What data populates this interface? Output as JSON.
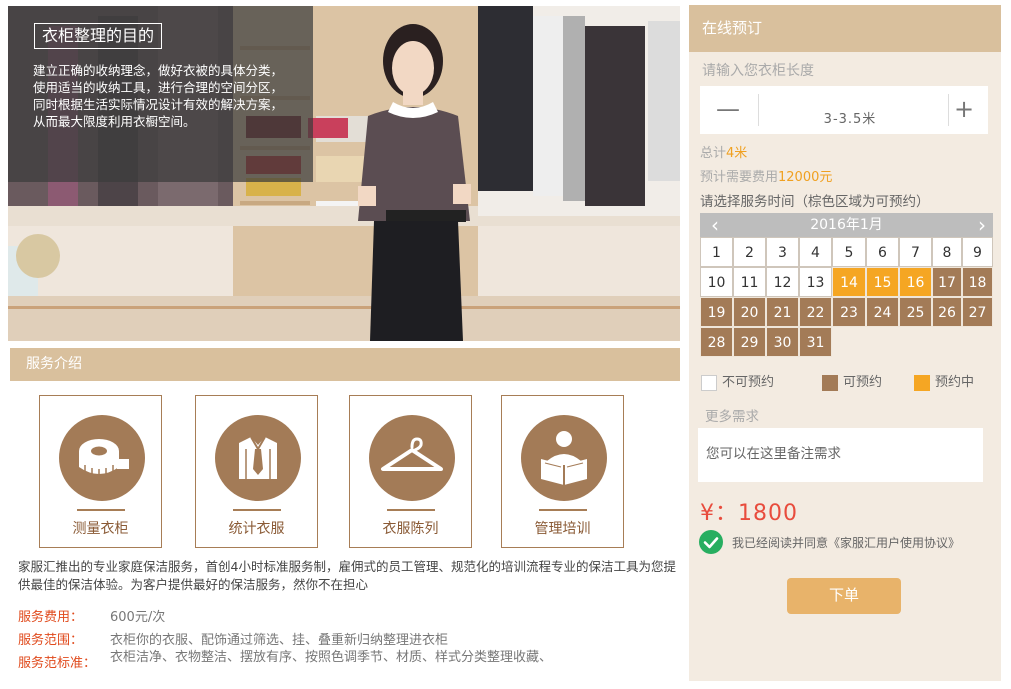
{
  "hero": {
    "title": "衣柜整理的目的",
    "text": "建立正确的收纳理念，做好衣被的具体分类，使用适当的收纳工具，进行合理的空间分区，同时根据生活实际情况设计有效的解决方案，从而最大限度利用衣橱空间。"
  },
  "services": {
    "header": "服务介绍",
    "items": [
      {
        "label": "测量衣柜",
        "icon": "measuring-tape-icon"
      },
      {
        "label": "统计衣服",
        "icon": "shirt-tie-icon"
      },
      {
        "label": "衣服陈列",
        "icon": "hanger-icon"
      },
      {
        "label": "管理培训",
        "icon": "reading-person-icon"
      }
    ],
    "description": "家服汇推出的专业家庭保洁服务，首创4小时标准服务制，雇佣式的员工管理、规范化的培训流程专业的保洁工具为您提供最佳的保洁体验。为客户提供最好的保洁服务，然你不在担心",
    "fee_label": "服务费用：",
    "fee_value": "600元/次",
    "scope_label": "服务范围：",
    "scope_value": "衣柜你的衣服、配饰通过筛选、挂、叠重新归纳整理进衣柜",
    "standard_label": "服务范标准：",
    "standard_value": "衣柜洁净、衣物整洁、摆放有序、按照色调季节、材质、样式分类整理收藏、"
  },
  "booking": {
    "header": "在线预订",
    "length_prompt": "请输入您衣柜长度",
    "minus": "—",
    "plus": "+",
    "length_value": "3-3.5米",
    "total_prefix": "总计",
    "total_value": "4米",
    "cost_prefix": "预计需要费用",
    "cost_value": "12000元",
    "time_prompt": "请选择服务时间（棕色区域为可预约）",
    "calendar": {
      "month": "2016年1月",
      "prev": "‹",
      "next": "›",
      "weeks": [
        [
          "1",
          "2",
          "3",
          "4",
          "5",
          "6",
          "7",
          "8",
          "9"
        ],
        [
          "10",
          "11",
          "12",
          "13",
          "14",
          "15",
          "16",
          "17",
          "18"
        ],
        [
          "19",
          "20",
          "21",
          "22",
          "23",
          "24",
          "25",
          "26",
          "27"
        ],
        [
          "28",
          "29",
          "30",
          "31"
        ]
      ],
      "booking_days": [
        "14",
        "15",
        "16"
      ],
      "unavailable_days": [
        "1",
        "2",
        "3",
        "4",
        "5",
        "6",
        "7",
        "8",
        "9",
        "10",
        "11",
        "12",
        "13"
      ]
    },
    "legend": {
      "unavailable": "不可预约",
      "available": "可预约",
      "booking": "预约中"
    },
    "more_label": "更多需求",
    "notes_placeholder": "您可以在这里备注需求",
    "price": "¥：1800",
    "agree_text": "我已经阅读并同意《家服汇用户使用协议》",
    "submit": "下单"
  },
  "colors": {
    "brown": "#a37b57",
    "tan": "#d9c09d",
    "orange": "#f5a623",
    "panel_bg": "#f3ebe1",
    "price_red": "#e84c3d",
    "check_green": "#27ae60"
  }
}
